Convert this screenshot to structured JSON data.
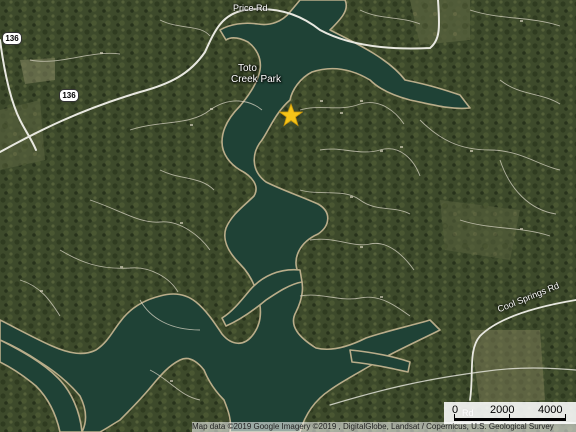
{
  "map": {
    "type": "satellite",
    "colors": {
      "water": "#1f4236",
      "forest": "#3b4a2a",
      "road": "#e8e8e0",
      "marker": "#f5c518"
    }
  },
  "labels": {
    "park": [
      "Toto",
      "Creek Park"
    ],
    "price_rd": "Price Rd",
    "cool_springs_rd": "Cool Springs Rd",
    "route_136_a": "136",
    "route_136_b": "136",
    "lower_rd": "Rd"
  },
  "marker": {
    "icon": "star-marker-icon"
  },
  "scale": {
    "labels": [
      "0",
      "2000",
      "4000"
    ]
  },
  "attribution": "Map data ©2019 Google  Imagery ©2019 , DigitalGlobe, Landsat / Copernicus, U.S. Geological Survey"
}
